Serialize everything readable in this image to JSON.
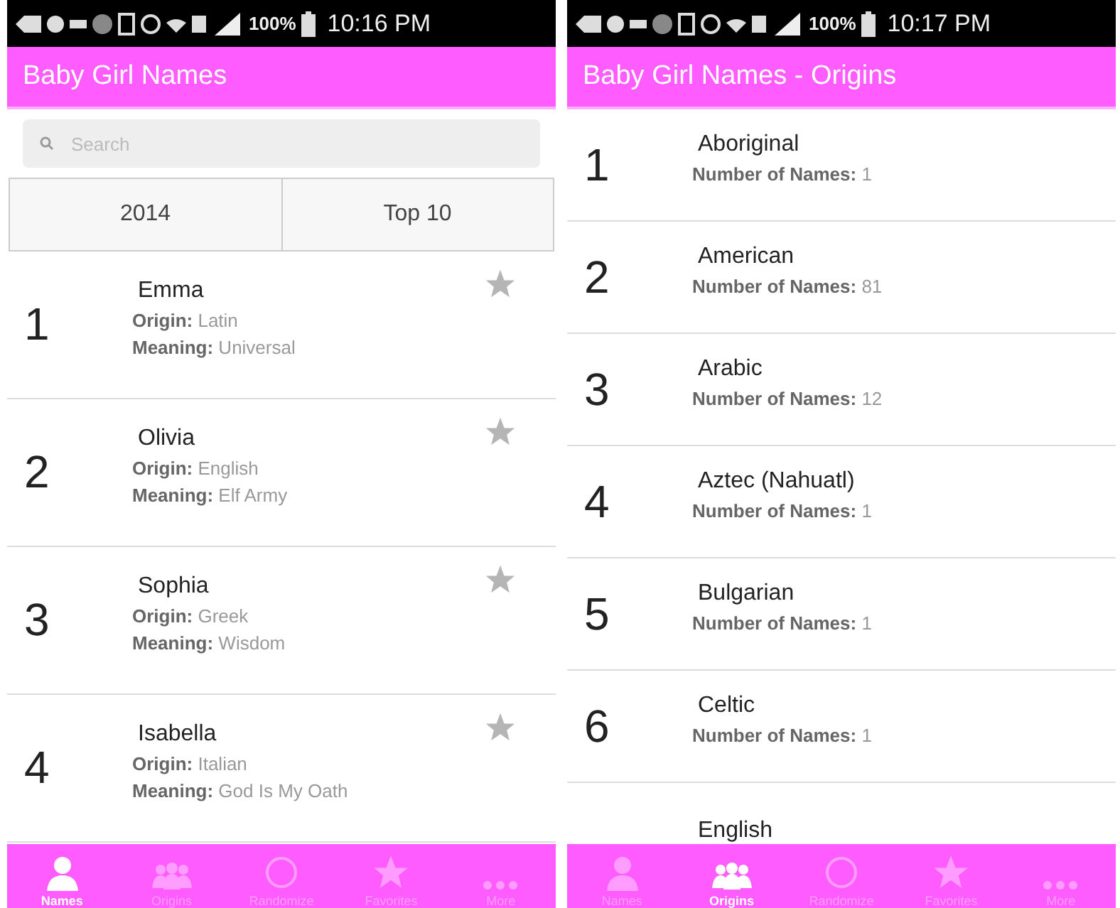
{
  "screens": [
    {
      "kind": "names",
      "status_bar": {
        "battery": "100%",
        "time": "10:16 PM"
      },
      "title": "Baby Girl Names",
      "search": {
        "placeholder": "Search"
      },
      "segments": [
        {
          "label": "2014",
          "selected": false
        },
        {
          "label": "Top 10",
          "selected": false
        }
      ],
      "items": [
        {
          "rank": "1",
          "name": "Emma",
          "origin_label": "Origin:",
          "origin": "Latin",
          "meaning_label": "Meaning:",
          "meaning": "Universal",
          "favorite": false
        },
        {
          "rank": "2",
          "name": "Olivia",
          "origin_label": "Origin:",
          "origin": "English",
          "meaning_label": "Meaning:",
          "meaning": "Elf Army",
          "favorite": false
        },
        {
          "rank": "3",
          "name": "Sophia",
          "origin_label": "Origin:",
          "origin": "Greek",
          "meaning_label": "Meaning:",
          "meaning": "Wisdom",
          "favorite": false
        },
        {
          "rank": "4",
          "name": "Isabella",
          "origin_label": "Origin:",
          "origin": "Italian",
          "meaning_label": "Meaning:",
          "meaning": "God Is My Oath",
          "favorite": false
        }
      ],
      "nav": [
        {
          "label": "Names",
          "selected": true
        },
        {
          "label": "Origins",
          "selected": false
        },
        {
          "label": "Randomize",
          "selected": false
        },
        {
          "label": "Favorites",
          "selected": false
        },
        {
          "label": "More",
          "selected": false
        }
      ]
    },
    {
      "kind": "origins",
      "status_bar": {
        "battery": "100%",
        "time": "10:17 PM"
      },
      "title": "Baby Girl Names - Origins",
      "items": [
        {
          "rank": "1",
          "name": "Aboriginal",
          "count_label": "Number of Names:",
          "count": "1"
        },
        {
          "rank": "2",
          "name": "American",
          "count_label": "Number of Names:",
          "count": "81"
        },
        {
          "rank": "3",
          "name": "Arabic",
          "count_label": "Number of Names:",
          "count": "12"
        },
        {
          "rank": "4",
          "name": "Aztec (Nahuatl)",
          "count_label": "Number of Names:",
          "count": "1"
        },
        {
          "rank": "5",
          "name": "Bulgarian",
          "count_label": "Number of Names:",
          "count": "1"
        },
        {
          "rank": "6",
          "name": "Celtic",
          "count_label": "Number of Names:",
          "count": "1"
        },
        {
          "name": "English"
        }
      ],
      "nav": [
        {
          "label": "Names",
          "selected": false
        },
        {
          "label": "Origins",
          "selected": true
        },
        {
          "label": "Randomize",
          "selected": false
        },
        {
          "label": "Favorites",
          "selected": false
        },
        {
          "label": "More",
          "selected": false
        }
      ]
    }
  ]
}
